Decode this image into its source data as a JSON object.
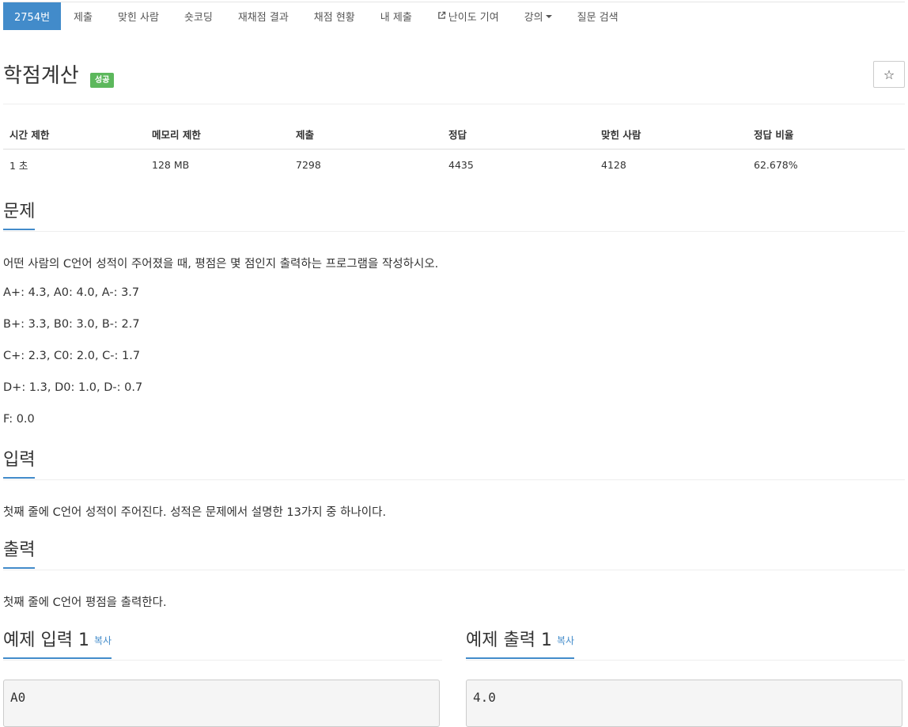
{
  "nav": {
    "items": [
      {
        "label": "2754번",
        "active": true
      },
      {
        "label": "제출"
      },
      {
        "label": "맞힌 사람"
      },
      {
        "label": "숏코딩"
      },
      {
        "label": "재채점 결과"
      },
      {
        "label": "채점 현황"
      },
      {
        "label": "내 제출"
      },
      {
        "label": "난이도 기여",
        "icon": "external-link-icon"
      },
      {
        "label": "강의",
        "icon": "caret-down-icon"
      },
      {
        "label": "질문 검색"
      }
    ]
  },
  "problem": {
    "title": "학점계산",
    "badge": "성공",
    "star_icon": "☆"
  },
  "info_table": {
    "headers": [
      "시간 제한",
      "메모리 제한",
      "제출",
      "정답",
      "맞힌 사람",
      "정답 비율"
    ],
    "values": [
      "1 초",
      "128 MB",
      "7298",
      "4435",
      "4128",
      "62.678%"
    ]
  },
  "sections": {
    "description": {
      "heading": "문제",
      "lines": [
        "어떤 사람의 C언어 성적이 주어졌을 때, 평점은 몇 점인지 출력하는 프로그램을 작성하시오.",
        "A+: 4.3, A0: 4.0, A-: 3.7",
        "B+: 3.3, B0: 3.0, B-: 2.7",
        "C+: 2.3, C0: 2.0, C-: 1.7",
        "D+: 1.3, D0: 1.0, D-: 0.7",
        "F: 0.0"
      ]
    },
    "input": {
      "heading": "입력",
      "text": "첫째 줄에 C언어 성적이 주어진다. 성적은 문제에서 설명한 13가지 중 하나이다."
    },
    "output": {
      "heading": "출력",
      "text": "첫째 줄에 C언어 평점을 출력한다."
    },
    "sample_input": {
      "heading": "예제 입력 1",
      "copy": "복사",
      "value": "A0"
    },
    "sample_output": {
      "heading": "예제 출력 1",
      "copy": "복사",
      "value": "4.0"
    }
  },
  "colors": {
    "accent": "#428bca",
    "success": "#5cb85c"
  }
}
